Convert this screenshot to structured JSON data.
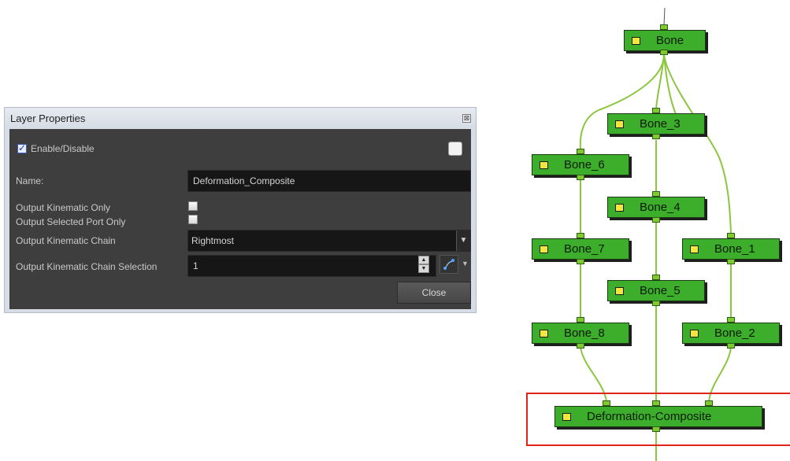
{
  "dialog": {
    "title": "Layer Properties",
    "close_glyph": "⊠",
    "enable_label": "Enable/Disable",
    "enable_checked": true,
    "name_label": "Name:",
    "name_value": "Deformation_Composite",
    "kinematic_only_label": "Output Kinematic Only",
    "selected_port_label": "Output Selected Port Only",
    "chain_label": "Output Kinematic Chain",
    "chain_value": "Rightmost",
    "chain_selection_label": "Output Kinematic Chain Selection",
    "chain_selection_value": "1",
    "close_button": "Close"
  },
  "nodes": {
    "bone": "Bone",
    "bone_3": "Bone_3",
    "bone_6": "Bone_6",
    "bone_4": "Bone_4",
    "bone_7": "Bone_7",
    "bone_1": "Bone_1",
    "bone_5": "Bone_5",
    "bone_8": "Bone_8",
    "bone_2": "Bone_2",
    "composite": "Deformation-Composite"
  },
  "colors": {
    "node_fill": "#3cae2b",
    "wire": "#8cc63f",
    "selection": "#e2231a",
    "icon": "#f3e63f"
  }
}
